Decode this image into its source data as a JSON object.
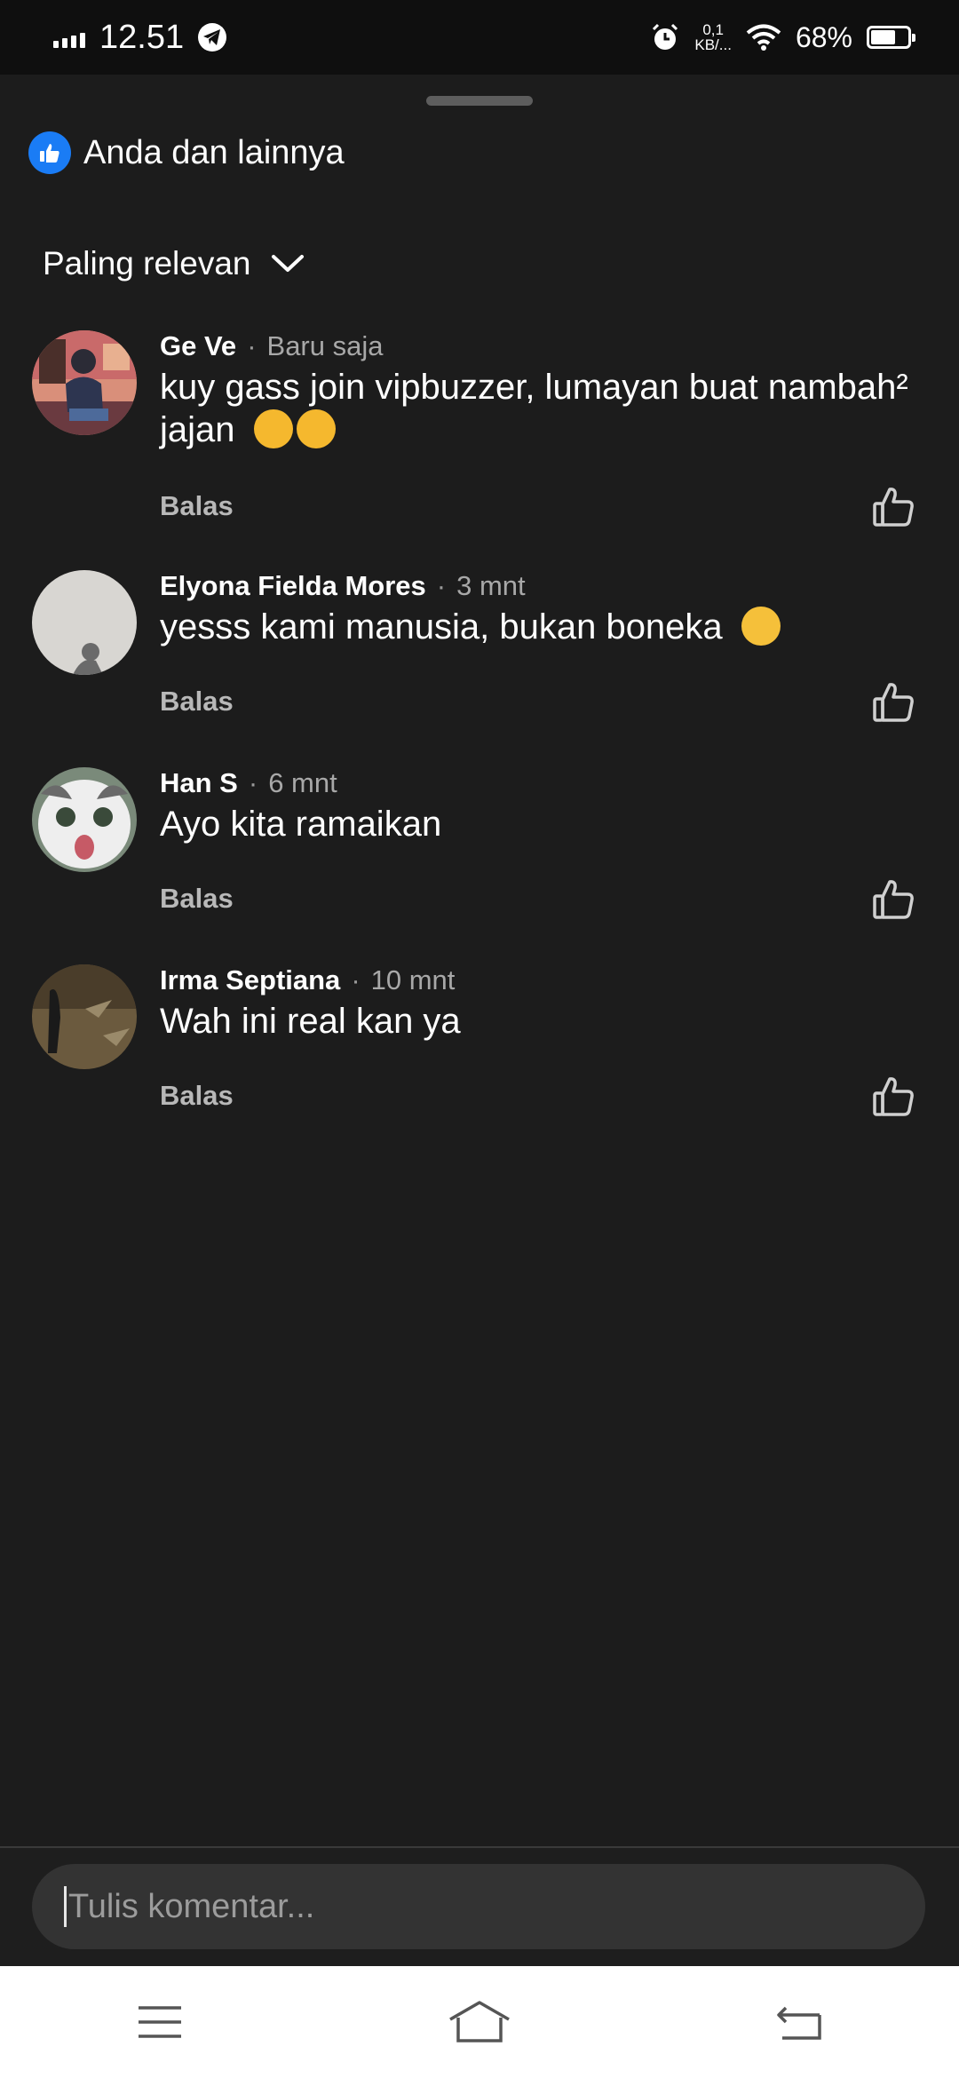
{
  "status_bar": {
    "time": "12.51",
    "net_speed_value": "0,1",
    "net_speed_unit": "KB/...",
    "battery_percent": "68%",
    "battery_level": 0.68
  },
  "reactions": {
    "text": "Anda dan lainnya"
  },
  "sort": {
    "label": "Paling relevan"
  },
  "comments": [
    {
      "name": "Ge Ve",
      "time": "Baru saja",
      "text_line1": "kuy gass join vipbuzzer, lumayan buat nambah²",
      "text_line2": "jajan",
      "emoji": "partying-face-emoji",
      "reply_label": "Balas"
    },
    {
      "name": "Elyona Fielda Mores",
      "time": "3 mnt",
      "text": "yesss kami manusia, bukan boneka",
      "emoji": "grinning-face-emoji",
      "reply_label": "Balas"
    },
    {
      "name": "Han S",
      "time": "6 mnt",
      "text": "Ayo kita ramaikan",
      "reply_label": "Balas"
    },
    {
      "name": "Irma Septiana",
      "time": "10 mnt",
      "text": "Wah ini real kan ya",
      "reply_label": "Balas"
    }
  ],
  "composer": {
    "placeholder": "Tulis komentar..."
  },
  "colors": {
    "background": "#1c1c1c",
    "accent_like": "#1a7cf5",
    "input_bg": "#333333",
    "nav_bar_bg": "#ffffff"
  },
  "icons": {
    "like_badge": "thumbs-up-icon",
    "sort": "chevron-down-icon",
    "comment_like": "thumbs-up-outline-icon",
    "nav_menu": "menu-icon",
    "nav_home": "home-icon",
    "nav_back": "back-icon"
  }
}
